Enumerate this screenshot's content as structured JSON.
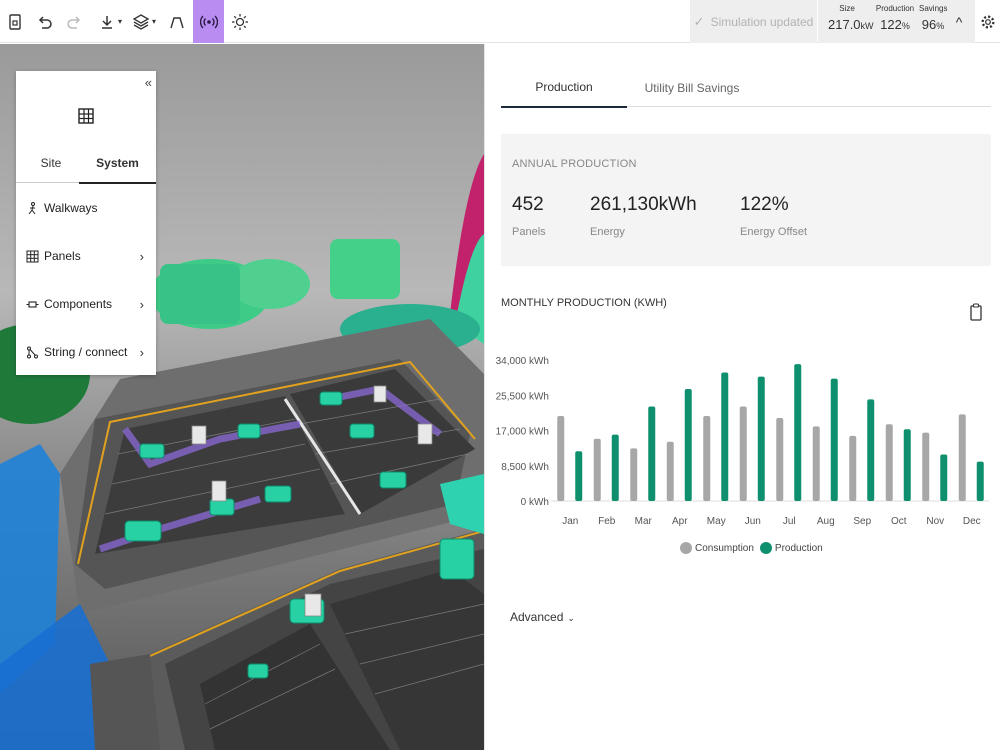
{
  "toolbar": {
    "icons": [
      "report-icon",
      "undo-icon",
      "redo-icon",
      "download-icon",
      "layers-icon",
      "shade-icon",
      "broadcast-icon",
      "sun-icon"
    ],
    "status_text": "Simulation updated",
    "stats": [
      {
        "label": "Size",
        "value": "217.0",
        "unit": "kW"
      },
      {
        "label": "Production",
        "value": "122",
        "unit": "%"
      },
      {
        "label": "Savings",
        "value": "96",
        "unit": "%"
      }
    ],
    "collapse_glyph": "^"
  },
  "sidepanel": {
    "collapse_glyph": "«",
    "tabs": [
      "Site",
      "System"
    ],
    "active_tab": "System",
    "items": [
      {
        "label": "Walkways",
        "icon": "walker-icon",
        "has_submenu": false
      },
      {
        "label": "Panels",
        "icon": "panel-grid-icon",
        "has_submenu": true
      },
      {
        "label": "Components",
        "icon": "component-icon",
        "has_submenu": true
      },
      {
        "label": "String / connect",
        "icon": "string-icon",
        "has_submenu": true
      }
    ],
    "chevron": "›"
  },
  "rightpanel": {
    "tabs": [
      "Production",
      "Utility Bill Savings"
    ],
    "active_tab": "Production",
    "annual": {
      "title": "ANNUAL PRODUCTION",
      "stats": [
        {
          "value": "452",
          "label": "Panels"
        },
        {
          "value": "261,130kWh",
          "label": "Energy"
        },
        {
          "value": "122%",
          "label": "Energy Offset"
        }
      ]
    },
    "monthly_title": "MONTHLY PRODUCTION (KWH)",
    "advanced_label": "Advanced",
    "advanced_glyph": "⌄"
  },
  "chart_data": {
    "type": "bar",
    "title": "MONTHLY PRODUCTION (KWH)",
    "categories": [
      "Jan",
      "Feb",
      "Mar",
      "Apr",
      "May",
      "Jun",
      "Jul",
      "Aug",
      "Sep",
      "Oct",
      "Nov",
      "Dec"
    ],
    "series": [
      {
        "name": "Consumption",
        "color": "#a7a7a7",
        "values": [
          20500,
          15000,
          12700,
          14300,
          20500,
          22800,
          20000,
          18000,
          15700,
          18500,
          16500,
          20900
        ]
      },
      {
        "name": "Production",
        "color": "#0e8f6e",
        "values": [
          12000,
          16000,
          22800,
          27000,
          31000,
          30000,
          33000,
          29500,
          24500,
          17300,
          11200,
          9500
        ]
      }
    ],
    "yticks": [
      "34,000 kWh",
      "25,500 kWh",
      "17,000 kWh",
      "8,500 kWh",
      "0 kWh"
    ],
    "ylim": [
      0,
      34000
    ],
    "legend_position": "bottom",
    "grid": false
  }
}
